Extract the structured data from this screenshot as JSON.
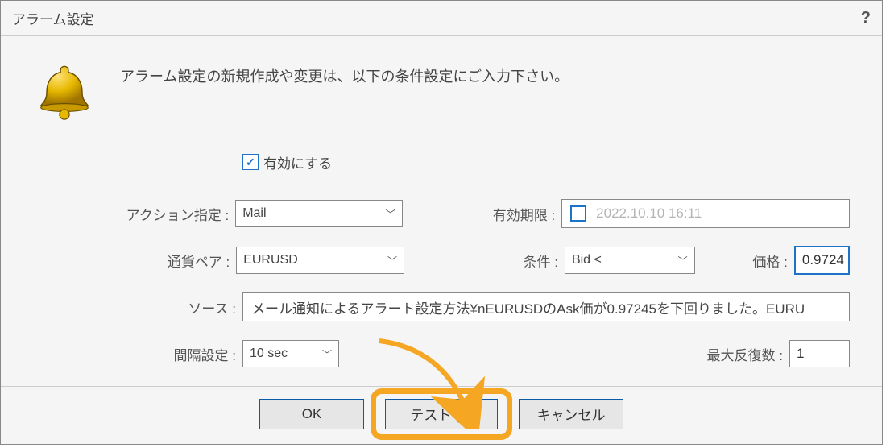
{
  "title": "アラーム設定",
  "intro": "アラーム設定の新規作成や変更は、以下の条件設定にご入力下さい。",
  "enable": {
    "label": "有効にする",
    "checked": true
  },
  "labels": {
    "action": "アクション指定 :",
    "symbol": "通貨ペア :",
    "source": "ソース :",
    "interval": "間隔設定 :",
    "expiry": "有効期限 :",
    "condition": "条件 :",
    "price": "価格 :",
    "maxrep": "最大反復数 :"
  },
  "values": {
    "action": "Mail",
    "symbol": "EURUSD",
    "interval": "10 sec",
    "expiry": "2022.10.10 16:11",
    "condition": "Bid <",
    "price": "0.9724",
    "maxrep": "1",
    "source": "メール通知によるアラート設定方法¥nEURUSDのAsk価が0.97245を下回りました。EURU"
  },
  "buttons": {
    "ok": "OK",
    "test": "テスト (T)",
    "cancel": "キャンセル"
  },
  "help": "?"
}
